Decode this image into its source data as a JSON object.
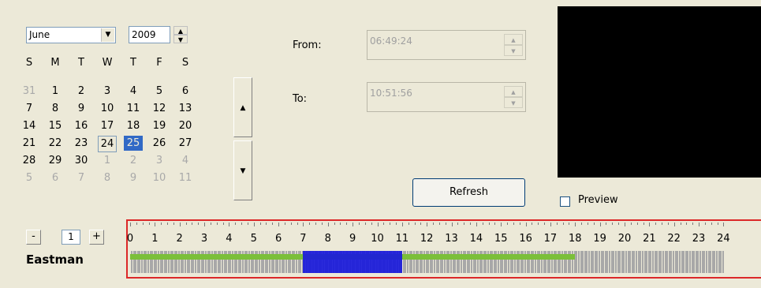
{
  "calendar": {
    "month": "June",
    "year": "2009",
    "weekdays": [
      "S",
      "M",
      "T",
      "W",
      "T",
      "F",
      "S"
    ],
    "weeks": [
      [
        "31",
        "1",
        "2",
        "3",
        "4",
        "5",
        "6"
      ],
      [
        "7",
        "8",
        "9",
        "10",
        "11",
        "12",
        "13"
      ],
      [
        "14",
        "15",
        "16",
        "17",
        "18",
        "19",
        "20"
      ],
      [
        "21",
        "22",
        "23",
        "24",
        "25",
        "26",
        "27"
      ],
      [
        "28",
        "29",
        "30",
        "1",
        "2",
        "3",
        "4"
      ],
      [
        "5",
        "6",
        "7",
        "8",
        "9",
        "10",
        "11"
      ]
    ]
  },
  "time": {
    "from_label": "From:",
    "from_value": "06:49:24",
    "to_label": "To:",
    "to_value": "10:51:56"
  },
  "refresh_label": "Refresh",
  "preview_label": "Preview",
  "pager": {
    "minus": "-",
    "page": "1",
    "plus": "+"
  },
  "camera_name": "Eastman",
  "timeline": {
    "hours": [
      "0",
      "1",
      "2",
      "3",
      "4",
      "5",
      "6",
      "7",
      "8",
      "9",
      "10",
      "11",
      "12",
      "13",
      "14",
      "15",
      "16",
      "17",
      "18",
      "19",
      "20",
      "21",
      "22",
      "23",
      "24"
    ],
    "recorded_range_hours": [
      0,
      18
    ],
    "selected_range_hours": [
      7,
      11
    ],
    "recorded_color": "#7bbf3a",
    "selected_color": "#1a1adc"
  }
}
